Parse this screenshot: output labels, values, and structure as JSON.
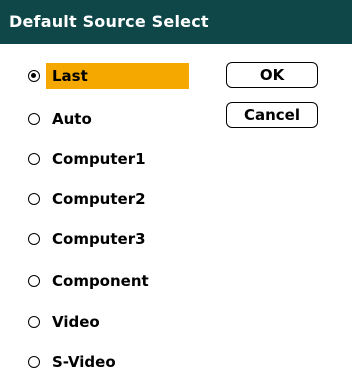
{
  "dialog": {
    "title": "Default Source Select"
  },
  "options": [
    {
      "label": "Last",
      "checked": true,
      "selected": true
    },
    {
      "label": "Auto",
      "checked": false,
      "selected": false
    },
    {
      "label": "Computer1",
      "checked": false,
      "selected": false
    },
    {
      "label": "Computer2",
      "checked": false,
      "selected": false
    },
    {
      "label": "Computer3",
      "checked": false,
      "selected": false
    },
    {
      "label": "Component",
      "checked": false,
      "selected": false
    },
    {
      "label": "Video",
      "checked": false,
      "selected": false
    },
    {
      "label": "S-Video",
      "checked": false,
      "selected": false
    }
  ],
  "buttons": {
    "ok_label": "OK",
    "cancel_label": "Cancel"
  },
  "colors": {
    "title_bar": "#0f4648",
    "highlight": "#f5a800"
  }
}
